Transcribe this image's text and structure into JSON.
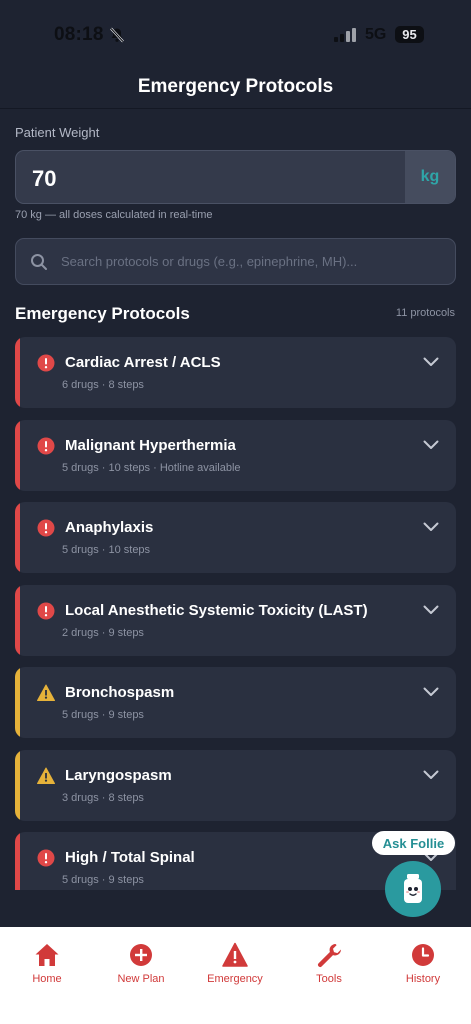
{
  "status_bar": {
    "time": "08:18",
    "network": "5G",
    "battery": "95"
  },
  "header": {
    "title": "Emergency Protocols"
  },
  "weight": {
    "label": "Patient Weight",
    "value": "70",
    "unit": "kg",
    "hint": "70 kg — all doses calculated in real-time"
  },
  "search": {
    "placeholder": "Search protocols or drugs (e.g., epinephrine, MH)..."
  },
  "section": {
    "title": "Emergency Protocols",
    "count": "11 protocols"
  },
  "protocols": [
    {
      "title": "Cardiac Arrest / ACLS",
      "subtitle": "6 drugs · 8 steps",
      "severity": "critical"
    },
    {
      "title": "Malignant Hyperthermia",
      "subtitle": "5 drugs · 10 steps · Hotline available",
      "severity": "critical"
    },
    {
      "title": "Anaphylaxis",
      "subtitle": "5 drugs · 10 steps",
      "severity": "critical"
    },
    {
      "title": "Local Anesthetic Systemic Toxicity (LAST)",
      "subtitle": "2 drugs · 9 steps",
      "severity": "critical"
    },
    {
      "title": "Bronchospasm",
      "subtitle": "5 drugs · 9 steps",
      "severity": "warning"
    },
    {
      "title": "Laryngospasm",
      "subtitle": "3 drugs · 8 steps",
      "severity": "warning"
    },
    {
      "title": "High / Total Spinal",
      "subtitle": "5 drugs · 9 steps",
      "severity": "critical"
    }
  ],
  "colors": {
    "critical": "#e04848",
    "warning": "#e6b23a",
    "accent": "#2a9a9f"
  },
  "assistant": {
    "label": "Ask Follie"
  },
  "tabs": [
    {
      "label": "Home",
      "icon": "home-icon"
    },
    {
      "label": "New Plan",
      "icon": "plus-circle-icon"
    },
    {
      "label": "Emergency",
      "icon": "alert-triangle-icon"
    },
    {
      "label": "Tools",
      "icon": "wrench-icon"
    },
    {
      "label": "History",
      "icon": "clock-icon"
    }
  ]
}
